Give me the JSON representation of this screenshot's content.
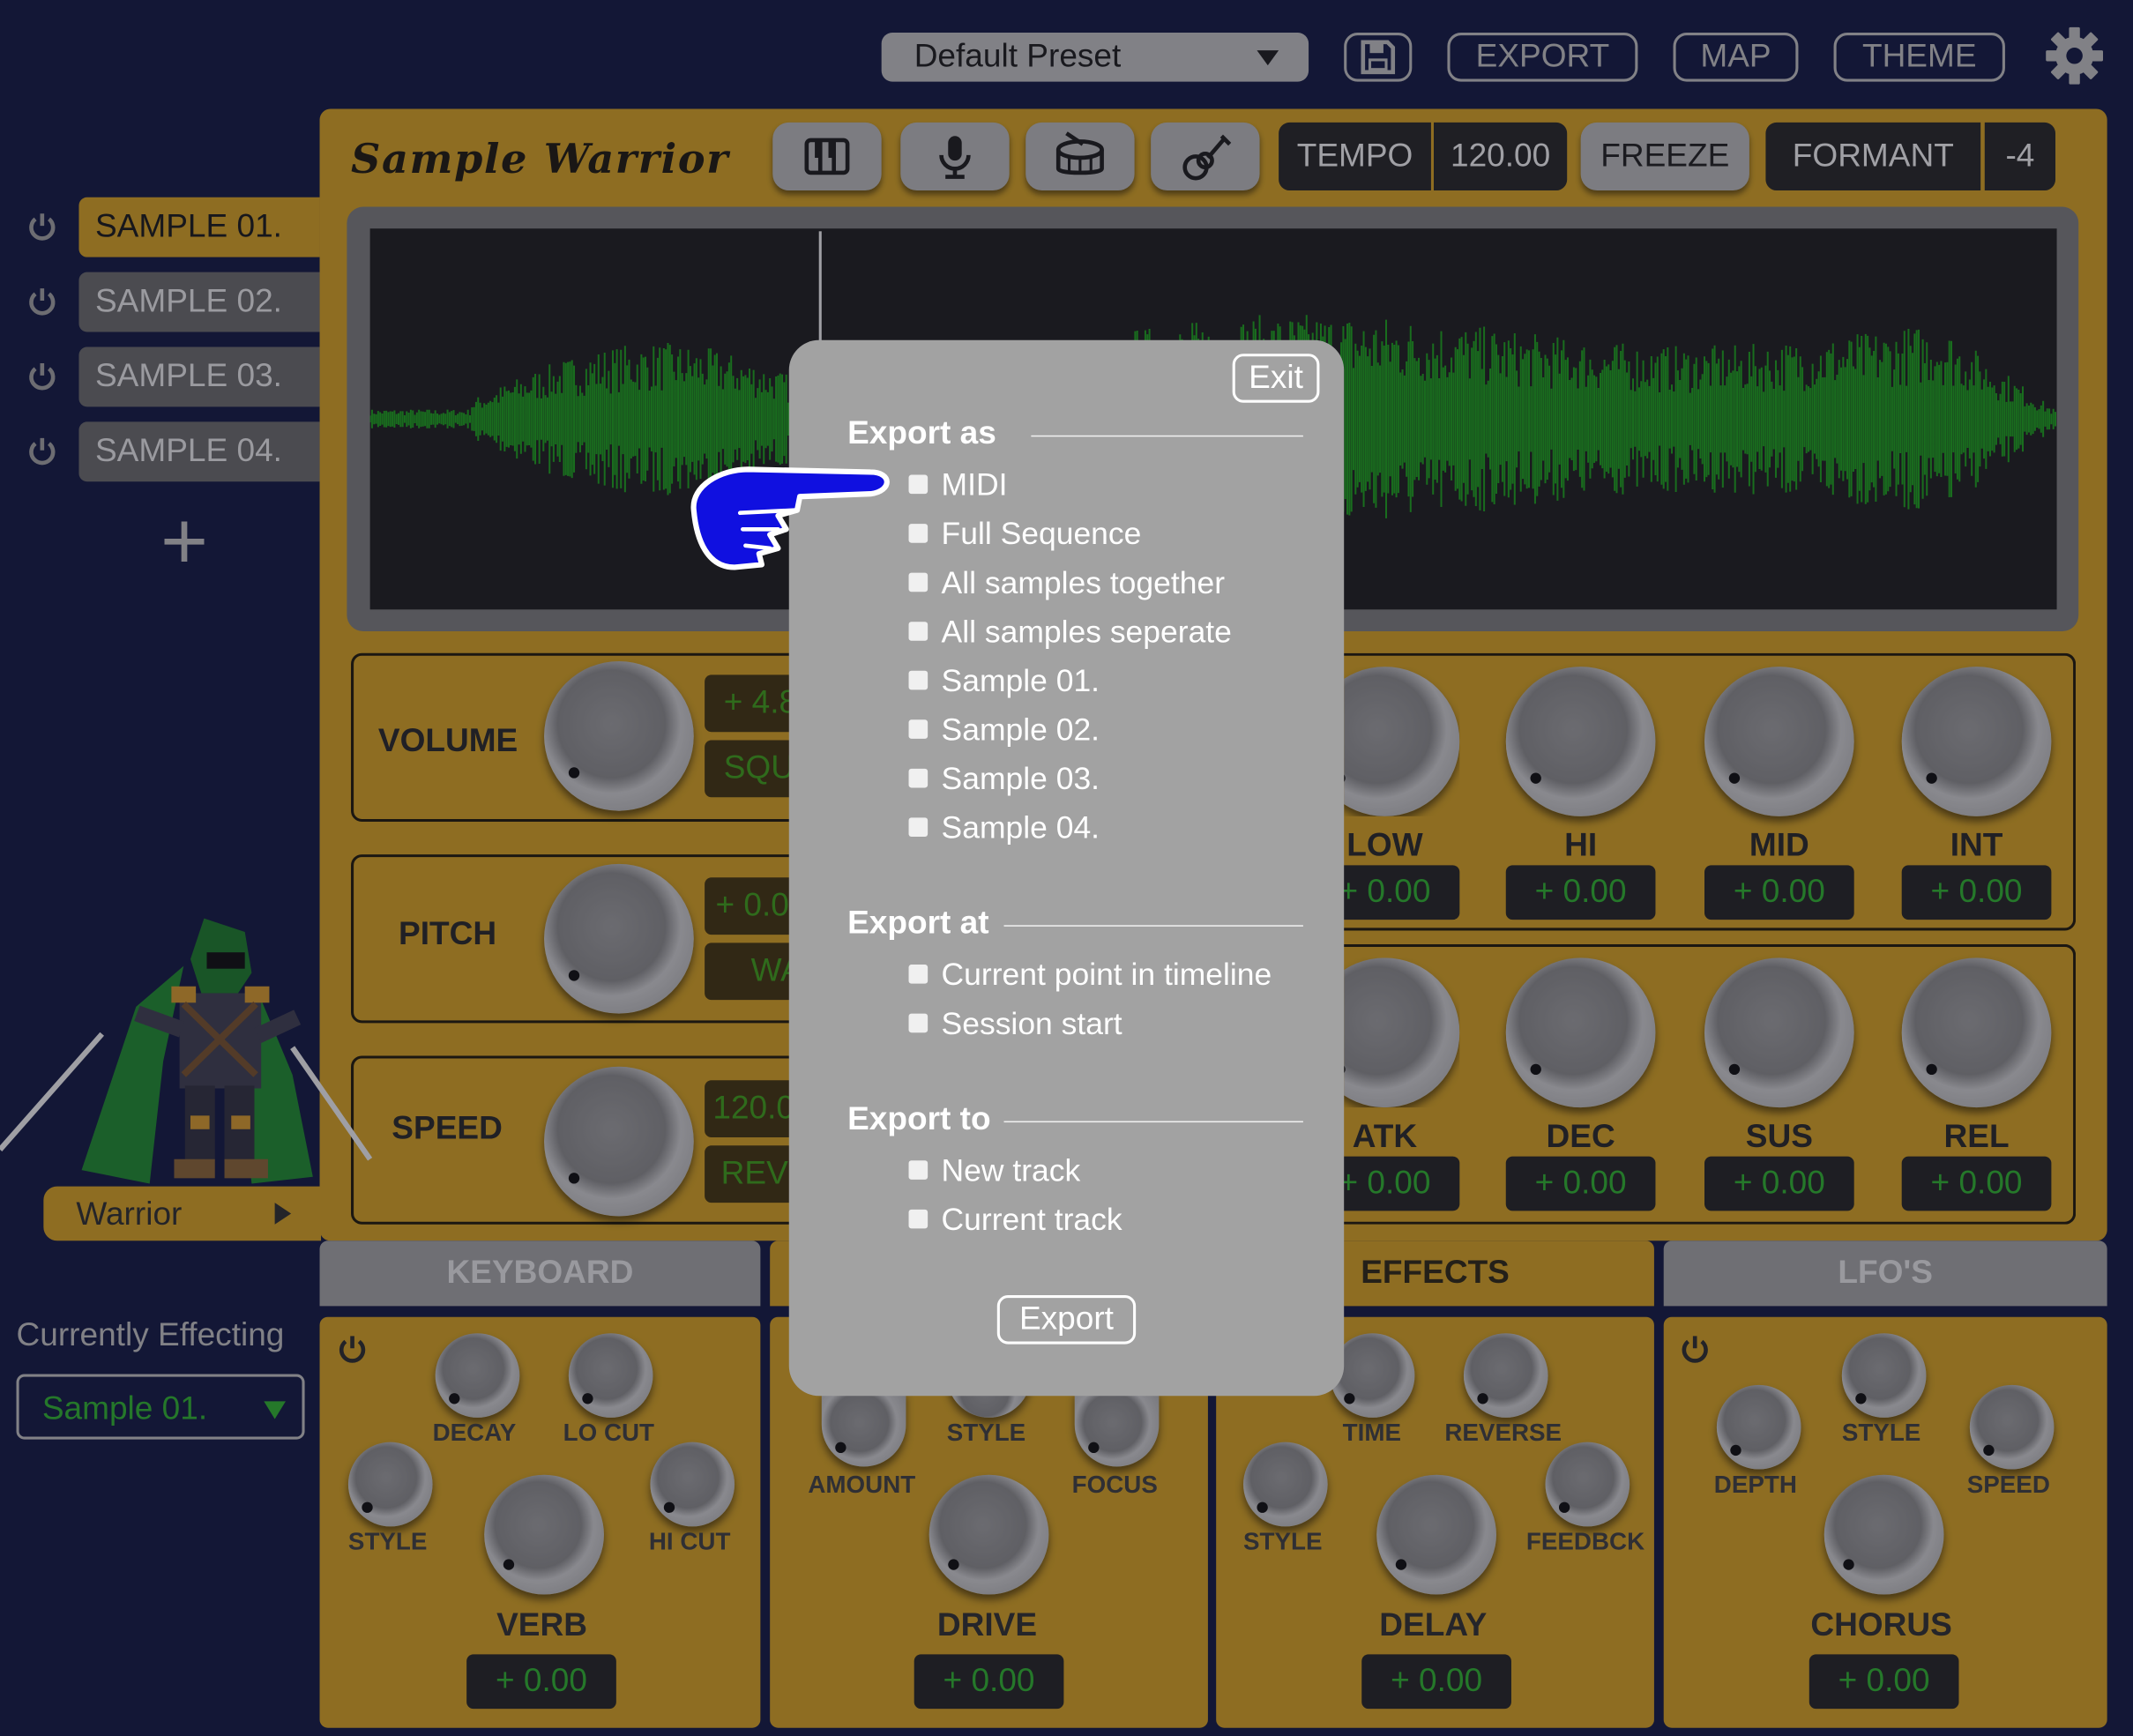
{
  "topbar": {
    "preset": "Default Preset",
    "export": "EXPORT",
    "map": "MAP",
    "theme": "THEME"
  },
  "header": {
    "logo": "Sample Warrior",
    "tempo_label": "TEMPO",
    "tempo_value": "120.00",
    "freeze": "FREEZE",
    "formant_label": "FORMANT",
    "formant_value": "-4"
  },
  "samples": [
    "SAMPLE 01.",
    "SAMPLE 02.",
    "SAMPLE 03.",
    "SAMPLE 04."
  ],
  "add": "+",
  "character": {
    "name": "Warrior"
  },
  "effecting": {
    "label": "Currently Effecting",
    "value": "Sample 01."
  },
  "controls": {
    "volume": {
      "label": "VOLUME",
      "value": "+ 4.8",
      "mode": "SQU"
    },
    "pitch": {
      "label": "PITCH",
      "value": "+ 0.0",
      "mode": "WA"
    },
    "speed": {
      "label": "SPEED",
      "value": "120.0",
      "mode": "REV"
    }
  },
  "eq": [
    {
      "label": "LOW",
      "value": "+ 0.00"
    },
    {
      "label": "HI",
      "value": "+ 0.00"
    },
    {
      "label": "MID",
      "value": "+ 0.00"
    },
    {
      "label": "INT",
      "value": "+ 0.00"
    }
  ],
  "env": [
    {
      "label": "ATK",
      "value": "+ 0.00"
    },
    {
      "label": "DEC",
      "value": "+ 0.00"
    },
    {
      "label": "SUS",
      "value": "+ 0.00"
    },
    {
      "label": "REL",
      "value": "+ 0.00"
    }
  ],
  "tabs": [
    "KEYBOARD",
    "",
    "EFFECTS",
    "LFO'S"
  ],
  "modules": [
    {
      "labels": [
        "DECAY",
        "LO CUT",
        "STYLE",
        "HI CUT"
      ],
      "name": "VERB",
      "value": "+ 0.00"
    },
    {
      "labels": [
        "STYLE",
        "AMOUNT",
        "FOCUS"
      ],
      "name": "DRIVE",
      "value": "+ 0.00"
    },
    {
      "labels": [
        "TIME",
        "REVERSE",
        "STYLE",
        "FEEDBCK"
      ],
      "name": "DELAY",
      "value": "+ 0.00"
    },
    {
      "labels": [
        "STYLE",
        "DEPTH",
        "SPEED"
      ],
      "name": "CHORUS",
      "value": "+ 0.00"
    }
  ],
  "modal": {
    "exit": "Exit",
    "export_as": {
      "title": "Export as",
      "items": [
        "MIDI",
        "Full Sequence",
        "All samples together",
        "All samples seperate",
        "Sample 01.",
        "Sample 02.",
        "Sample 03.",
        "Sample 04."
      ]
    },
    "export_at": {
      "title": "Export at",
      "items": [
        "Current point in timeline",
        "Session start"
      ]
    },
    "export_to": {
      "title": "Export to",
      "items": [
        "New track",
        "Current track"
      ]
    },
    "button": "Export"
  },
  "colors": {
    "background": "#141a3c",
    "panel": "#b88d22",
    "waveform": "#1c8c1c",
    "value_text": "#2c9b2c",
    "pointer": "#1010e0"
  },
  "icons": [
    "floppy-icon",
    "gear-icon",
    "keyboard-icon",
    "microphone-icon",
    "drum-icon",
    "guitar-icon",
    "power-icon",
    "pointing-hand-icon"
  ]
}
